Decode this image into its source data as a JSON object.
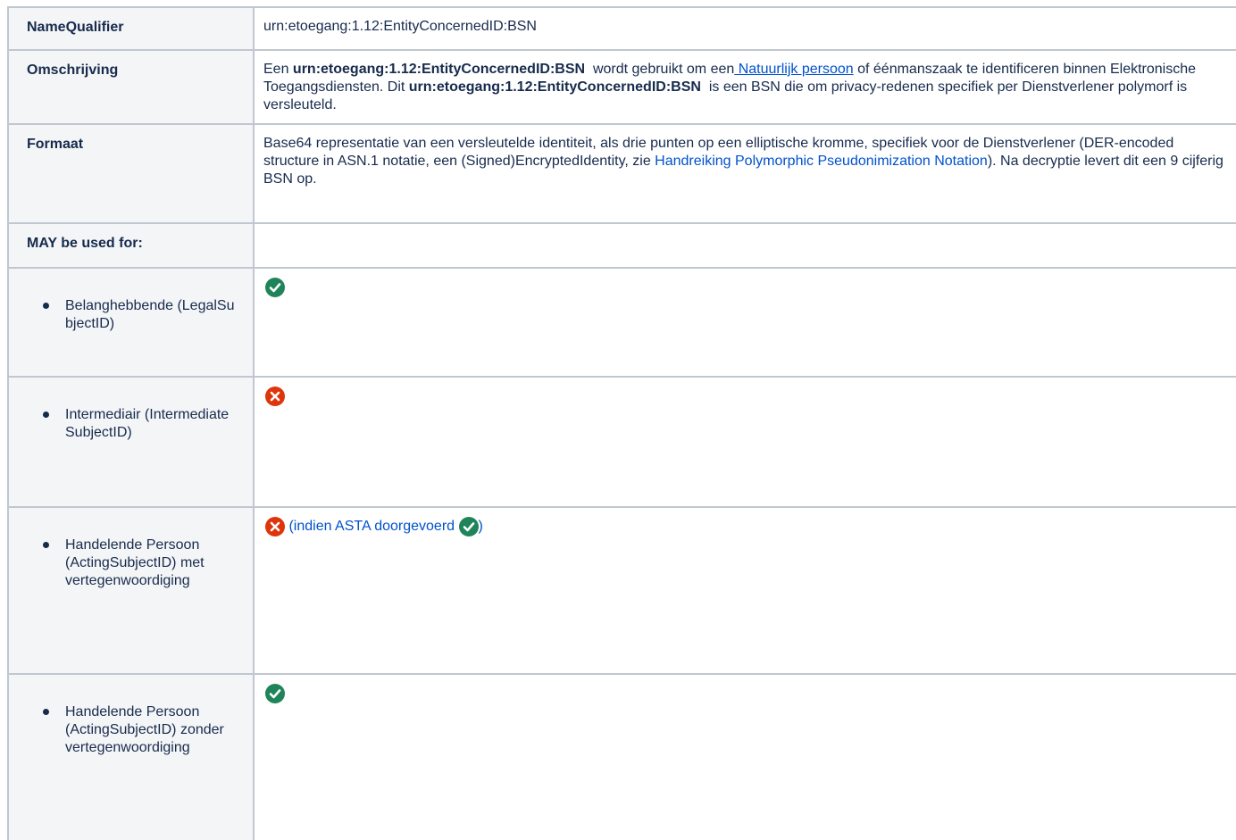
{
  "rows": {
    "namequalifier": {
      "label": "NameQualifier",
      "value": "urn:etoegang:1.12:EntityConcernedID:BSN"
    },
    "omschrijving": {
      "label": "Omschrijving",
      "p1": "Een ",
      "bold1": "urn:etoegang:1.12:EntityConcernedID:BSN",
      "p2": "  wordt gebruikt om een",
      "link": " Natuurlijk persoon",
      "p3": " of éénmanszaak te identificeren binnen Elektronische Toegangsdiensten. Dit ",
      "bold2": "urn:etoegang:1.12:EntityConcernedID:BSN",
      "p4": "  is een BSN die om privacy-redenen specifiek per Dienstverlener polymorf is versleuteld."
    },
    "formaat": {
      "label": "Formaat",
      "p1": "Base64 representatie van een versleutelde identiteit, als drie punten op een elliptische kromme, specifiek voor de Dienstverlener (DER-encoded structure in ASN.1 notatie, een (Signed)EncryptedIdentity, zie ",
      "link": "Handreiking Polymorphic Pseudonimization Notation",
      "p2": "). Na decryptie levert dit een 9 cijferig BSN op."
    },
    "may": {
      "label": "MAY be used for:"
    },
    "uses": [
      {
        "label": "Belanghebbende (LegalSubjectID)",
        "status": "check-icon"
      },
      {
        "label": "Intermediair (IntermediateSubjectID)",
        "status": "cross-icon"
      },
      {
        "label": "Handelende Persoon (ActingSubjectID) met vertegenwoordiging",
        "status": "cross-icon",
        "note": "(indien ASTA doorgevoerd ",
        "note_end": ")"
      },
      {
        "label": "Handelende Persoon (ActingSubjectID) zonder vertegenwoordiging",
        "status": "check-icon"
      }
    ]
  },
  "colors": {
    "check": "#1f845a",
    "cross": "#de350b",
    "link": "#0052cc",
    "header_bg": "#f4f5f7",
    "border": "#c1c7d0"
  }
}
